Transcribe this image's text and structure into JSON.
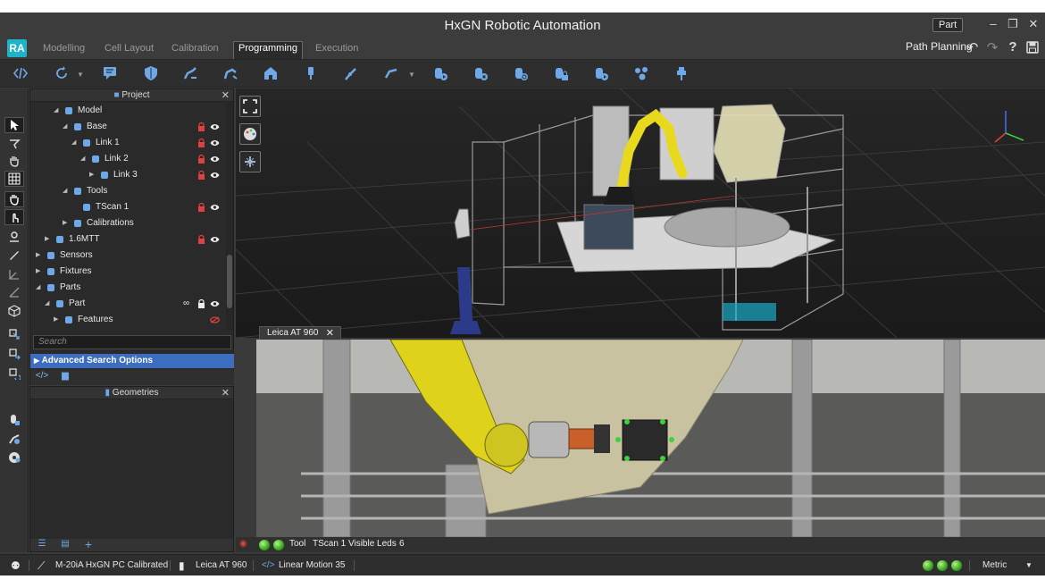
{
  "window": {
    "title": "HxGN Robotic Automation",
    "part_badge": "Part",
    "minimize_icon": "minimize-icon",
    "maximize_icon": "maximize-icon",
    "close_icon": "close-icon"
  },
  "logo": "RA",
  "tabs": [
    {
      "label": "Modelling",
      "active": false
    },
    {
      "label": "Cell Layout",
      "active": false
    },
    {
      "label": "Calibration",
      "active": false
    },
    {
      "label": "Programming",
      "active": true
    },
    {
      "label": "Execution",
      "active": false
    }
  ],
  "header_right": {
    "path_planning": "Path Planning",
    "icons": [
      "undo-icon",
      "redo-icon",
      "help-icon",
      "save-icon"
    ]
  },
  "project_panel": {
    "title": "Project",
    "tree": [
      {
        "label": "Model",
        "icon": "model-icon",
        "indent": 2,
        "expanded": true,
        "lock": false,
        "eye": false
      },
      {
        "label": "Base",
        "icon": "link-icon",
        "indent": 3,
        "expanded": true,
        "lock": true,
        "eye": true
      },
      {
        "label": "Link 1",
        "icon": "link-icon",
        "indent": 4,
        "expanded": true,
        "lock": true,
        "eye": true
      },
      {
        "label": "Link 2",
        "icon": "link-icon",
        "indent": 5,
        "expanded": true,
        "lock": true,
        "eye": true
      },
      {
        "label": "Link 3",
        "icon": "link-icon",
        "indent": 6,
        "expanded": false,
        "lock": true,
        "eye": true
      },
      {
        "label": "Tools",
        "icon": "tool-icon",
        "indent": 3,
        "expanded": true,
        "lock": false,
        "eye": false
      },
      {
        "label": "TScan 1",
        "icon": "scanner-icon",
        "indent": 4,
        "expanded": null,
        "lock": true,
        "eye": true
      },
      {
        "label": "Calibrations",
        "icon": "calibration-icon",
        "indent": 3,
        "expanded": false,
        "lock": false,
        "eye": false
      },
      {
        "label": "1.6MTT",
        "icon": "tracker-icon",
        "indent": 1,
        "expanded": false,
        "lock": true,
        "eye": true
      },
      {
        "label": "Sensors",
        "icon": "sensor-icon",
        "indent": 0,
        "expanded": false,
        "lock": false,
        "eye": false
      },
      {
        "label": "Fixtures",
        "icon": "fixture-icon",
        "indent": 0,
        "expanded": false,
        "lock": false,
        "eye": false
      },
      {
        "label": "Parts",
        "icon": "parts-icon",
        "indent": 0,
        "expanded": true,
        "lock": false,
        "eye": false
      },
      {
        "label": "Part",
        "icon": "part-icon",
        "indent": 1,
        "expanded": true,
        "lock": true,
        "eye": true,
        "link": true
      },
      {
        "label": "Features",
        "icon": "features-icon",
        "indent": 2,
        "expanded": false,
        "lock": false,
        "eye": false,
        "hidden": true
      }
    ],
    "search_placeholder": "Search",
    "advanced_search": "Advanced Search Options"
  },
  "geometries_panel": {
    "title": "Geometries"
  },
  "viewport_bottom_tab": "Leica AT 960",
  "tool_status": {
    "tool_label": "Tool",
    "tool_value": "TScan 1",
    "leds_label": "Visible Leds",
    "leds_value": "6"
  },
  "statusbar": {
    "robot": "M-20iA HxGN PC Calibrated",
    "tracker": "Leica AT 960",
    "motion": "Linear Motion 35",
    "units": "Metric"
  },
  "colors": {
    "accent_blue": "#3d6dbf",
    "logo": "#1fb3c7",
    "lock_red": "#e04040",
    "robot_yellow": "#e8d81e",
    "led_green": "#36a81e"
  }
}
